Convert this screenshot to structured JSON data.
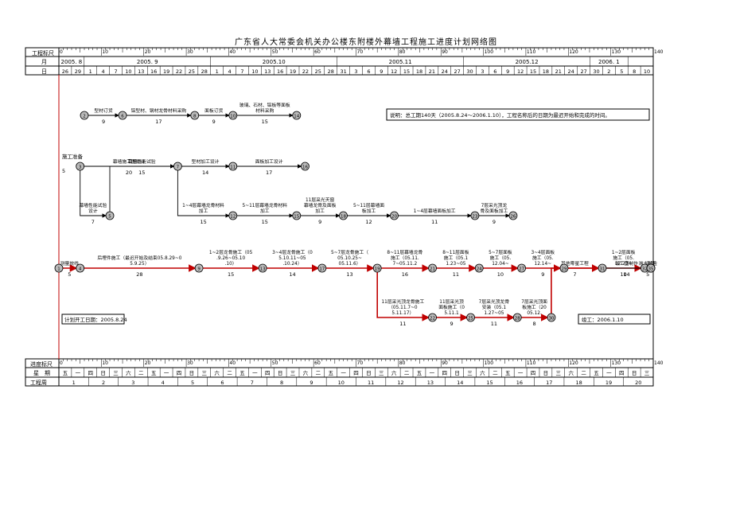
{
  "title": "广东省人大常委会机关办公楼东附楼外幕墙工程施工进度计划网络图",
  "header": {
    "scale_label": "工程标尺",
    "month_label": "月",
    "day_label": "日",
    "scale_ticks": [
      "0",
      "10",
      "20",
      "30",
      "40",
      "50",
      "60",
      "70",
      "80",
      "90",
      "100",
      "110",
      "120",
      "130",
      "140"
    ],
    "months": [
      {
        "label": "2005. 8",
        "start": 0,
        "end": 2
      },
      {
        "label": "2005. 9",
        "start": 2,
        "end": 12
      },
      {
        "label": "2005.10",
        "start": 12,
        "end": 22
      },
      {
        "label": "2005.11",
        "start": 22,
        "end": 32
      },
      {
        "label": "2005.12",
        "start": 32,
        "end": 42
      },
      {
        "label": "2006. 1",
        "start": 42,
        "end": 45
      }
    ],
    "days": [
      "26",
      "29",
      "1",
      "4",
      "7",
      "10",
      "13",
      "16",
      "19",
      "22",
      "25",
      "28",
      "1",
      "4",
      "7",
      "10",
      "13",
      "16",
      "19",
      "22",
      "25",
      "28",
      "31",
      "3",
      "6",
      "9",
      "12",
      "15",
      "18",
      "21",
      "24",
      "27",
      "30",
      "3",
      "6",
      "9",
      "12",
      "15",
      "18",
      "21",
      "24",
      "27",
      "30",
      "2",
      "5",
      "8",
      "10"
    ]
  },
  "footer": {
    "progress_label": "进度标尺",
    "week_label": "星　期",
    "cycle_label": "工程周",
    "weekdays": [
      "五",
      "一",
      "四",
      "日",
      "三",
      "六",
      "二",
      "五",
      "一",
      "四",
      "日",
      "三",
      "六",
      "二",
      "五",
      "一",
      "四",
      "日",
      "三",
      "六",
      "二",
      "五",
      "一",
      "四",
      "日",
      "三",
      "六",
      "二",
      "五",
      "一",
      "四",
      "日",
      "三",
      "六",
      "二",
      "五",
      "一",
      "四",
      "日",
      "三",
      "六",
      "二",
      "五",
      "一",
      "四",
      "日",
      "三"
    ],
    "weeks": [
      "1",
      "2",
      "3",
      "4",
      "5",
      "6",
      "7",
      "8",
      "9",
      "10",
      "11",
      "12",
      "13",
      "14",
      "15",
      "16",
      "17",
      "18",
      "19",
      "20"
    ]
  },
  "notes": {
    "explanation": "说明：总工期140天（2005.8.24～2006.1.10），工程名称后的日期为最迟开始和完成的时间。",
    "plan_start": "计划开工日期：2005.8.24",
    "completion": "竣工：2006.1.10"
  },
  "network": {
    "nodes": [
      {
        "id": "1",
        "day": 0,
        "row": "crit"
      },
      {
        "id": "2",
        "day": 6,
        "row": "top"
      },
      {
        "id": "3",
        "day": 5,
        "row": "design"
      },
      {
        "id": "4",
        "day": 5,
        "row": "crit"
      },
      {
        "id": "5",
        "day": 12,
        "row": "sample"
      },
      {
        "id": "6",
        "day": 15,
        "row": "top"
      },
      {
        "id": "7",
        "day": 28,
        "row": "design"
      },
      {
        "id": "8",
        "day": 32,
        "row": "top"
      },
      {
        "id": "9",
        "day": 33,
        "row": "crit"
      },
      {
        "id": "10",
        "day": 41,
        "row": "top"
      },
      {
        "id": "11",
        "day": 41,
        "row": "design"
      },
      {
        "id": "12",
        "day": 41,
        "row": "sample"
      },
      {
        "id": "13",
        "day": 48,
        "row": "crit"
      },
      {
        "id": "14",
        "day": 56,
        "row": "top"
      },
      {
        "id": "15",
        "day": 56,
        "row": "sample"
      },
      {
        "id": "16",
        "day": 58,
        "row": "design"
      },
      {
        "id": "17",
        "day": 62,
        "row": "crit"
      },
      {
        "id": "18",
        "day": 67,
        "row": "sample"
      },
      {
        "id": "19",
        "day": 75,
        "row": "crit"
      },
      {
        "id": "20",
        "day": 79,
        "row": "sample"
      },
      {
        "id": "21",
        "day": 88,
        "row": "crit"
      },
      {
        "id": "22",
        "day": 88,
        "row": "lower"
      },
      {
        "id": "23",
        "day": 98,
        "row": "sample"
      },
      {
        "id": "24",
        "day": 99,
        "row": "crit"
      },
      {
        "id": "25",
        "day": 97,
        "row": "lower"
      },
      {
        "id": "26",
        "day": 107,
        "row": "sample"
      },
      {
        "id": "27",
        "day": 109,
        "row": "crit"
      },
      {
        "id": "28",
        "day": 108,
        "row": "lower"
      },
      {
        "id": "29",
        "day": 119,
        "row": "crit"
      },
      {
        "id": "30",
        "day": 116,
        "row": "lower"
      },
      {
        "id": "31",
        "day": 128,
        "row": "crit"
      },
      {
        "id": "32",
        "day": 138,
        "row": "crit"
      },
      {
        "id": "33",
        "day": 141,
        "row": "crit"
      },
      {
        "id": "34",
        "day": 143,
        "row": "crit"
      },
      {
        "id": "35",
        "day": 146,
        "row": "crit"
      }
    ],
    "activities": [
      {
        "from": "2",
        "to": "6",
        "label": "型材订货",
        "dur": "9",
        "crit": false
      },
      {
        "from": "6",
        "to": "8",
        "label": "铝型材、钢材龙骨材料采购",
        "dur": "17",
        "crit": false
      },
      {
        "from": "8",
        "to": "10",
        "label": "面板订货",
        "dur": "9",
        "crit": false
      },
      {
        "from": "10",
        "to": "14",
        "label": "玻璃、石材、铝板等面板材料采购",
        "dur": "15",
        "crit": false
      },
      {
        "from": "3",
        "to": "7",
        "label": "幕墙施工图设计",
        "dur": "20",
        "crit": false
      },
      {
        "from": "7",
        "to": "11",
        "label": "型材加工设计",
        "dur": "14",
        "crit": false
      },
      {
        "from": "11",
        "to": "16",
        "label": "面板加工设计",
        "dur": "17",
        "crit": false
      },
      {
        "from": "3",
        "to": "5",
        "label": "幕墙性能试验设计",
        "dur": "7",
        "crit": false
      },
      {
        "from": "5",
        "to": "7",
        "label": "幕墙性能试验",
        "dur": "15",
        "crit": false
      },
      {
        "from": "7",
        "to": "12",
        "label": "1~4层幕墙龙骨材料加工",
        "dur": "15",
        "crit": false
      },
      {
        "from": "12",
        "to": "15",
        "label": "5~11层幕墙龙骨材料加工",
        "dur": "15",
        "crit": false
      },
      {
        "from": "15",
        "to": "18",
        "label": "11层采光天窗幕墙龙骨及面板加工",
        "dur": "9",
        "crit": false
      },
      {
        "from": "18",
        "to": "20",
        "label": "5~11层幕墙面板加工",
        "dur": "12",
        "crit": false
      },
      {
        "from": "20",
        "to": "23",
        "label": "1~4层幕墙面板加工",
        "dur": "11",
        "crit": false
      },
      {
        "from": "23",
        "to": "26",
        "label": "7层采光顶龙骨及面板加工",
        "dur": "9",
        "crit": false
      },
      {
        "from": "1",
        "to": "4",
        "label": "测量放线",
        "dur": "5",
        "crit": true
      },
      {
        "from": "4",
        "to": "9",
        "label": "后埋件施工（最迟开始及结束05.8.29~05.9.25）",
        "dur": "28",
        "crit": true
      },
      {
        "from": "9",
        "to": "13",
        "label": "1~2层龙骨施工（05.9.26~05.10.10）",
        "dur": "15",
        "crit": true
      },
      {
        "from": "13",
        "to": "17",
        "label": "3~4层龙骨施工（05.10.11~05.10.24）",
        "dur": "14",
        "crit": true
      },
      {
        "from": "17",
        "to": "19",
        "label": "5~7层龙骨施工（05.10.25~05.11.6）",
        "dur": "13",
        "crit": true
      },
      {
        "from": "19",
        "to": "21",
        "label": "8~11层幕墙龙骨施工（05.11.7~05.11.22）",
        "dur": "16",
        "crit": true
      },
      {
        "from": "21",
        "to": "24",
        "label": "8~11层面板施工（05.11.23~05.12.03）",
        "dur": "11",
        "crit": true
      },
      {
        "from": "24",
        "to": "27",
        "label": "5~7层面板施工（05.12.04~05.12.13）",
        "dur": "10",
        "crit": true
      },
      {
        "from": "27",
        "to": "29",
        "label": "3~4层面板施工（05.12.14~05.12.22）",
        "dur": "9",
        "crit": true
      },
      {
        "from": "29",
        "to": "31",
        "label": "",
        "dur": "",
        "crit": true
      },
      {
        "from": "31",
        "to": "32",
        "label": "1~2层面板施工（05.12.23~06.1.1）",
        "dur": "10",
        "crit": true
      },
      {
        "from": "32",
        "to": "33",
        "label": "淋水试验",
        "dur": "5",
        "crit": true
      },
      {
        "from": "33",
        "to": "34",
        "label": "清理",
        "dur": "",
        "crit": true
      },
      {
        "from": "34",
        "to": "35",
        "label": "",
        "dur": "",
        "crit": true
      },
      {
        "from": "19",
        "to": "22",
        "label": "11层采光顶龙骨施工（05.11.7~05.11.17）",
        "dur": "11",
        "crit": true
      },
      {
        "from": "22",
        "to": "25",
        "label": "11层采光顶面板施工（05.11.18~05.11.26）",
        "dur": "9",
        "crit": true
      },
      {
        "from": "25",
        "to": "28",
        "label": "7层采光顶龙骨安装（05.11.27~05.12.7）",
        "dur": "11",
        "crit": true
      },
      {
        "from": "28",
        "to": "30",
        "label": "7层采光顶面板施工（2005.12.8~05.12.15）",
        "dur": "8",
        "crit": true
      },
      {
        "from": "30",
        "to": "31",
        "label": "其他零星工程",
        "dur": "7",
        "crit": true
      },
      {
        "from": "31",
        "to": "34",
        "label": "竣工图制作",
        "dur": "14",
        "crit": false
      }
    ],
    "extra_labels": [
      {
        "text": "施工准备",
        "day": 0,
        "row": "design"
      },
      {
        "text": "5",
        "day": 0,
        "row": "design_dur"
      }
    ]
  }
}
